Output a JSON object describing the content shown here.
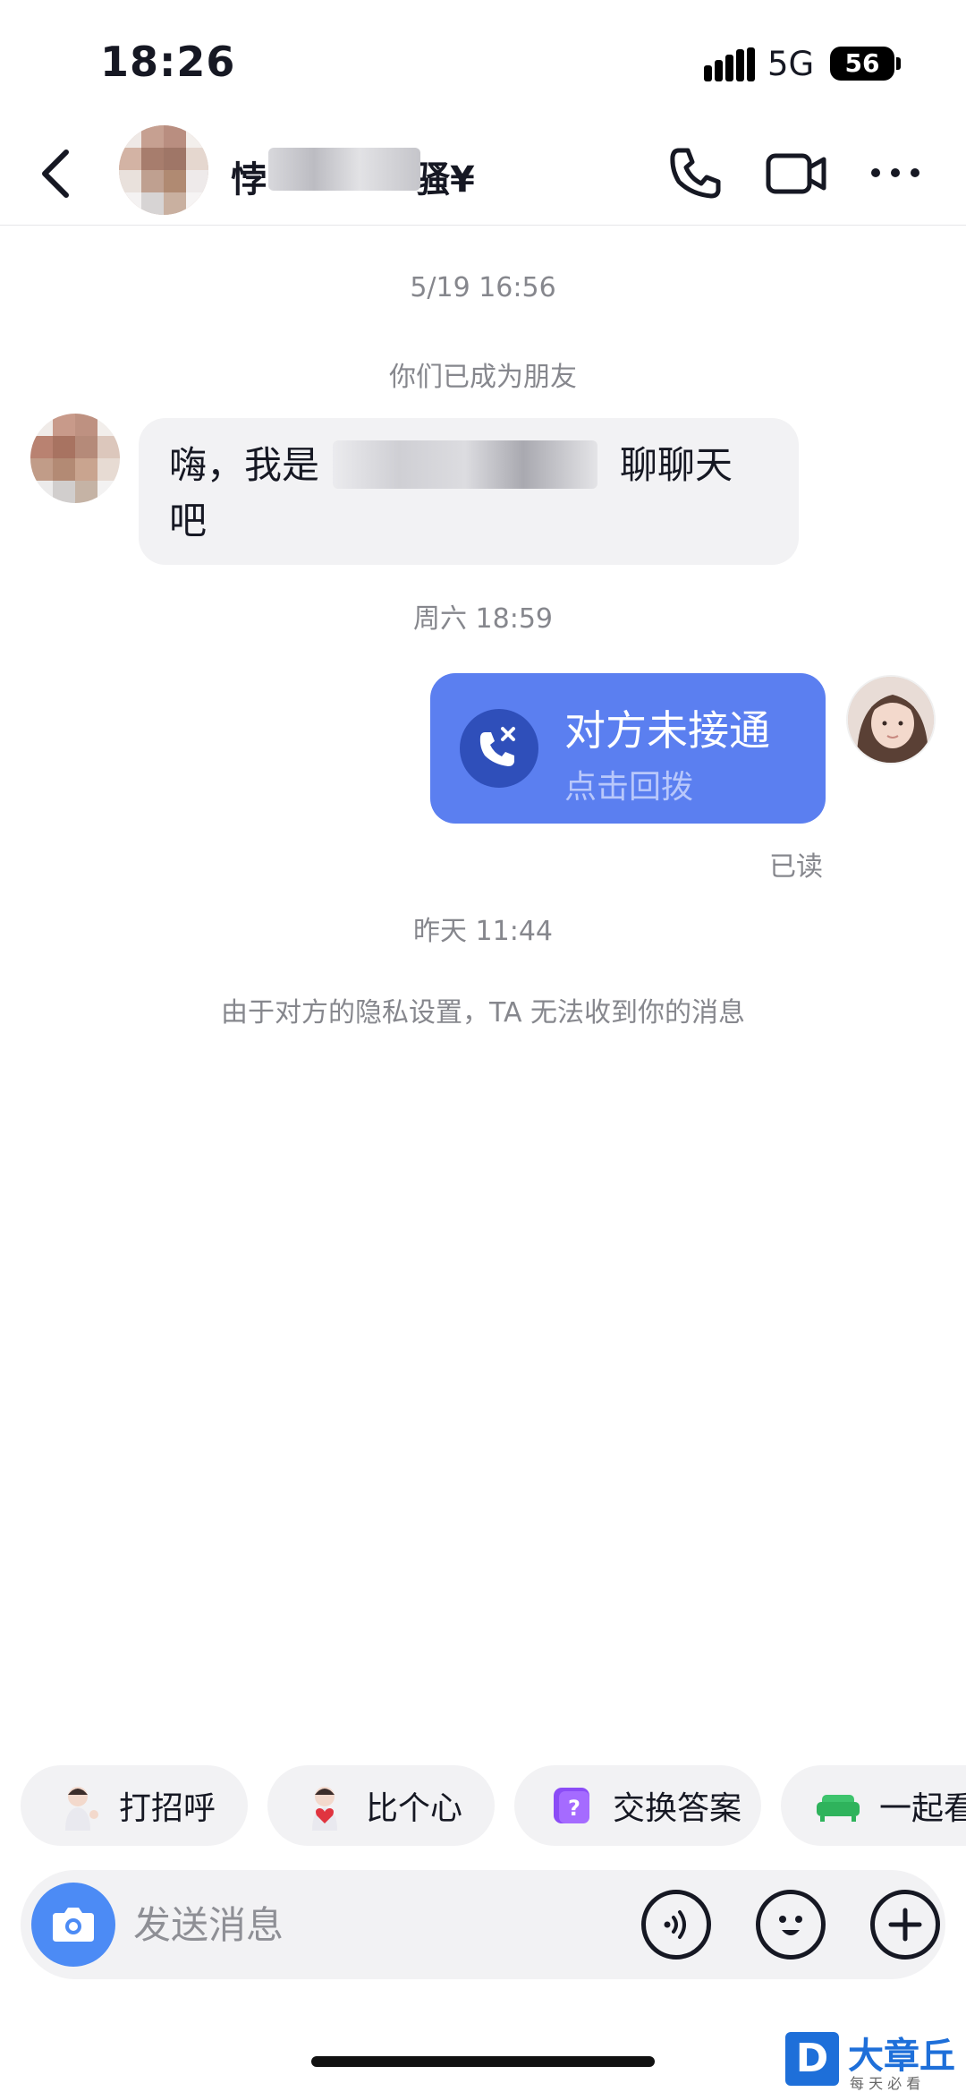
{
  "status_bar": {
    "time": "18:26",
    "network": "5G",
    "battery": "56"
  },
  "header": {
    "title_visible": "悖",
    "title_tail": "骚¥",
    "icons": [
      "back-icon",
      "phone-icon",
      "video-camera-icon",
      "more-icon"
    ]
  },
  "messages": {
    "ts1": "5/19 16:56",
    "friend_notice": "你们已成为朋友",
    "peer_prefix": "嗨，我是",
    "peer_gap": "　　　　　　　",
    "peer_suffix": "，聊聊天吧",
    "ts2": "周六 18:59",
    "call_title": "对方未接通",
    "call_sub": "点击回拨",
    "read_status": "已读",
    "ts3": "昨天 11:44",
    "privacy_notice": "由于对方的隐私设置，TA 无法收到你的消息"
  },
  "quick_chips": [
    {
      "label": "打招呼",
      "icon": "wave-sticker-icon"
    },
    {
      "label": "比个心",
      "icon": "heart-sticker-icon"
    },
    {
      "label": "交换答案",
      "icon": "question-box-icon"
    },
    {
      "label": "一起看",
      "icon": "sofa-icon"
    }
  ],
  "input": {
    "placeholder": "发送消息",
    "icons": [
      "camera-icon",
      "voice-icon",
      "emoji-icon",
      "plus-icon"
    ]
  },
  "watermark": {
    "brand": "大章丘",
    "slogan": "每 天 必 看",
    "mark": "D"
  },
  "colors": {
    "call_bubble": "#5b7ff0",
    "camera_button": "#4c8bf5",
    "bubble_gray": "#f2f2f4"
  }
}
